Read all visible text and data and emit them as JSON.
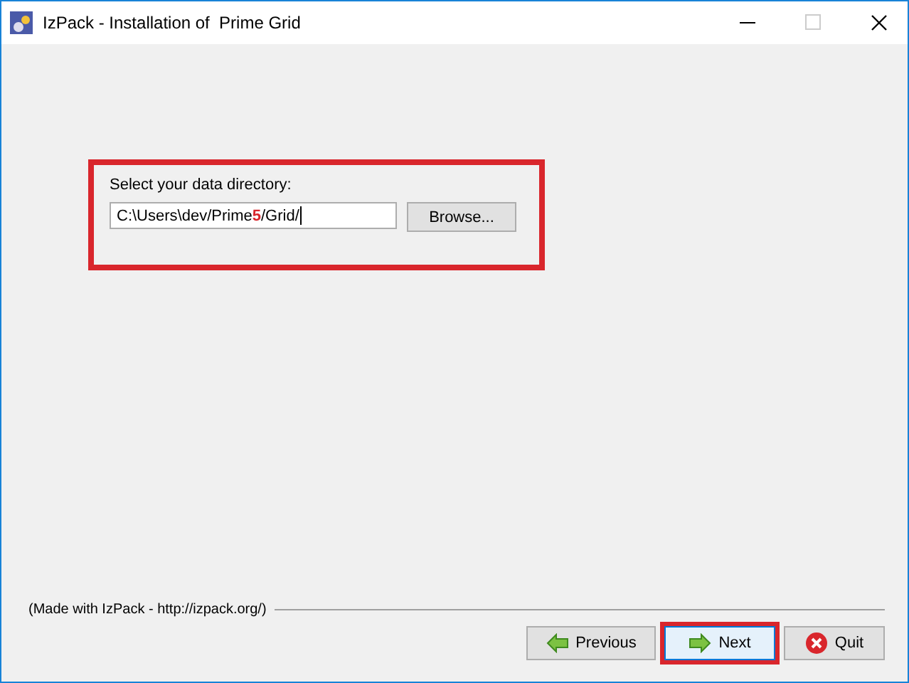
{
  "window": {
    "title": "IzPack - Installation of  Prime Grid"
  },
  "directory_panel": {
    "highlighted": true,
    "label": "Select your data directory:",
    "path": "C:\\Users\\dev/Prime**5**/Grid/",
    "browse_button": "Browse..."
  },
  "footer": {
    "credit": "(Made with IzPack - http://izpack.org/)"
  },
  "buttons": [
    {
      "kind": "previous",
      "label": "Previous",
      "focused": false,
      "highlighted": false
    },
    {
      "kind": "next",
      "label": "Next",
      "focused": true,
      "highlighted": true
    },
    {
      "kind": "quit",
      "label": "Quit",
      "focused": false,
      "highlighted": false
    }
  ]
}
